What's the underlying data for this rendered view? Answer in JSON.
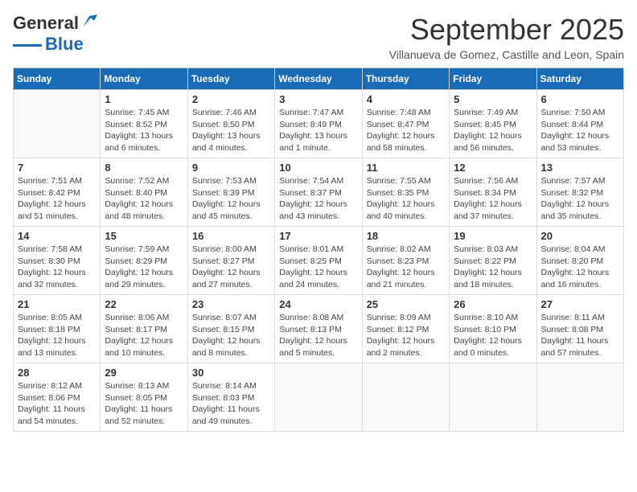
{
  "logo": {
    "line1": "General",
    "line2": "Blue"
  },
  "header": {
    "month": "September 2025",
    "location": "Villanueva de Gomez, Castille and Leon, Spain"
  },
  "weekdays": [
    "Sunday",
    "Monday",
    "Tuesday",
    "Wednesday",
    "Thursday",
    "Friday",
    "Saturday"
  ],
  "weeks": [
    [
      {
        "day": "",
        "info": ""
      },
      {
        "day": "1",
        "info": "Sunrise: 7:45 AM\nSunset: 8:52 PM\nDaylight: 13 hours\nand 6 minutes."
      },
      {
        "day": "2",
        "info": "Sunrise: 7:46 AM\nSunset: 8:50 PM\nDaylight: 13 hours\nand 4 minutes."
      },
      {
        "day": "3",
        "info": "Sunrise: 7:47 AM\nSunset: 8:49 PM\nDaylight: 13 hours\nand 1 minute."
      },
      {
        "day": "4",
        "info": "Sunrise: 7:48 AM\nSunset: 8:47 PM\nDaylight: 12 hours\nand 58 minutes."
      },
      {
        "day": "5",
        "info": "Sunrise: 7:49 AM\nSunset: 8:45 PM\nDaylight: 12 hours\nand 56 minutes."
      },
      {
        "day": "6",
        "info": "Sunrise: 7:50 AM\nSunset: 8:44 PM\nDaylight: 12 hours\nand 53 minutes."
      }
    ],
    [
      {
        "day": "7",
        "info": "Sunrise: 7:51 AM\nSunset: 8:42 PM\nDaylight: 12 hours\nand 51 minutes."
      },
      {
        "day": "8",
        "info": "Sunrise: 7:52 AM\nSunset: 8:40 PM\nDaylight: 12 hours\nand 48 minutes."
      },
      {
        "day": "9",
        "info": "Sunrise: 7:53 AM\nSunset: 8:39 PM\nDaylight: 12 hours\nand 45 minutes."
      },
      {
        "day": "10",
        "info": "Sunrise: 7:54 AM\nSunset: 8:37 PM\nDaylight: 12 hours\nand 43 minutes."
      },
      {
        "day": "11",
        "info": "Sunrise: 7:55 AM\nSunset: 8:35 PM\nDaylight: 12 hours\nand 40 minutes."
      },
      {
        "day": "12",
        "info": "Sunrise: 7:56 AM\nSunset: 8:34 PM\nDaylight: 12 hours\nand 37 minutes."
      },
      {
        "day": "13",
        "info": "Sunrise: 7:57 AM\nSunset: 8:32 PM\nDaylight: 12 hours\nand 35 minutes."
      }
    ],
    [
      {
        "day": "14",
        "info": "Sunrise: 7:58 AM\nSunset: 8:30 PM\nDaylight: 12 hours\nand 32 minutes."
      },
      {
        "day": "15",
        "info": "Sunrise: 7:59 AM\nSunset: 8:29 PM\nDaylight: 12 hours\nand 29 minutes."
      },
      {
        "day": "16",
        "info": "Sunrise: 8:00 AM\nSunset: 8:27 PM\nDaylight: 12 hours\nand 27 minutes."
      },
      {
        "day": "17",
        "info": "Sunrise: 8:01 AM\nSunset: 8:25 PM\nDaylight: 12 hours\nand 24 minutes."
      },
      {
        "day": "18",
        "info": "Sunrise: 8:02 AM\nSunset: 8:23 PM\nDaylight: 12 hours\nand 21 minutes."
      },
      {
        "day": "19",
        "info": "Sunrise: 8:03 AM\nSunset: 8:22 PM\nDaylight: 12 hours\nand 18 minutes."
      },
      {
        "day": "20",
        "info": "Sunrise: 8:04 AM\nSunset: 8:20 PM\nDaylight: 12 hours\nand 16 minutes."
      }
    ],
    [
      {
        "day": "21",
        "info": "Sunrise: 8:05 AM\nSunset: 8:18 PM\nDaylight: 12 hours\nand 13 minutes."
      },
      {
        "day": "22",
        "info": "Sunrise: 8:06 AM\nSunset: 8:17 PM\nDaylight: 12 hours\nand 10 minutes."
      },
      {
        "day": "23",
        "info": "Sunrise: 8:07 AM\nSunset: 8:15 PM\nDaylight: 12 hours\nand 8 minutes."
      },
      {
        "day": "24",
        "info": "Sunrise: 8:08 AM\nSunset: 8:13 PM\nDaylight: 12 hours\nand 5 minutes."
      },
      {
        "day": "25",
        "info": "Sunrise: 8:09 AM\nSunset: 8:12 PM\nDaylight: 12 hours\nand 2 minutes."
      },
      {
        "day": "26",
        "info": "Sunrise: 8:10 AM\nSunset: 8:10 PM\nDaylight: 12 hours\nand 0 minutes."
      },
      {
        "day": "27",
        "info": "Sunrise: 8:11 AM\nSunset: 8:08 PM\nDaylight: 11 hours\nand 57 minutes."
      }
    ],
    [
      {
        "day": "28",
        "info": "Sunrise: 8:12 AM\nSunset: 8:06 PM\nDaylight: 11 hours\nand 54 minutes."
      },
      {
        "day": "29",
        "info": "Sunrise: 8:13 AM\nSunset: 8:05 PM\nDaylight: 11 hours\nand 52 minutes."
      },
      {
        "day": "30",
        "info": "Sunrise: 8:14 AM\nSunset: 8:03 PM\nDaylight: 11 hours\nand 49 minutes."
      },
      {
        "day": "",
        "info": ""
      },
      {
        "day": "",
        "info": ""
      },
      {
        "day": "",
        "info": ""
      },
      {
        "day": "",
        "info": ""
      }
    ]
  ]
}
